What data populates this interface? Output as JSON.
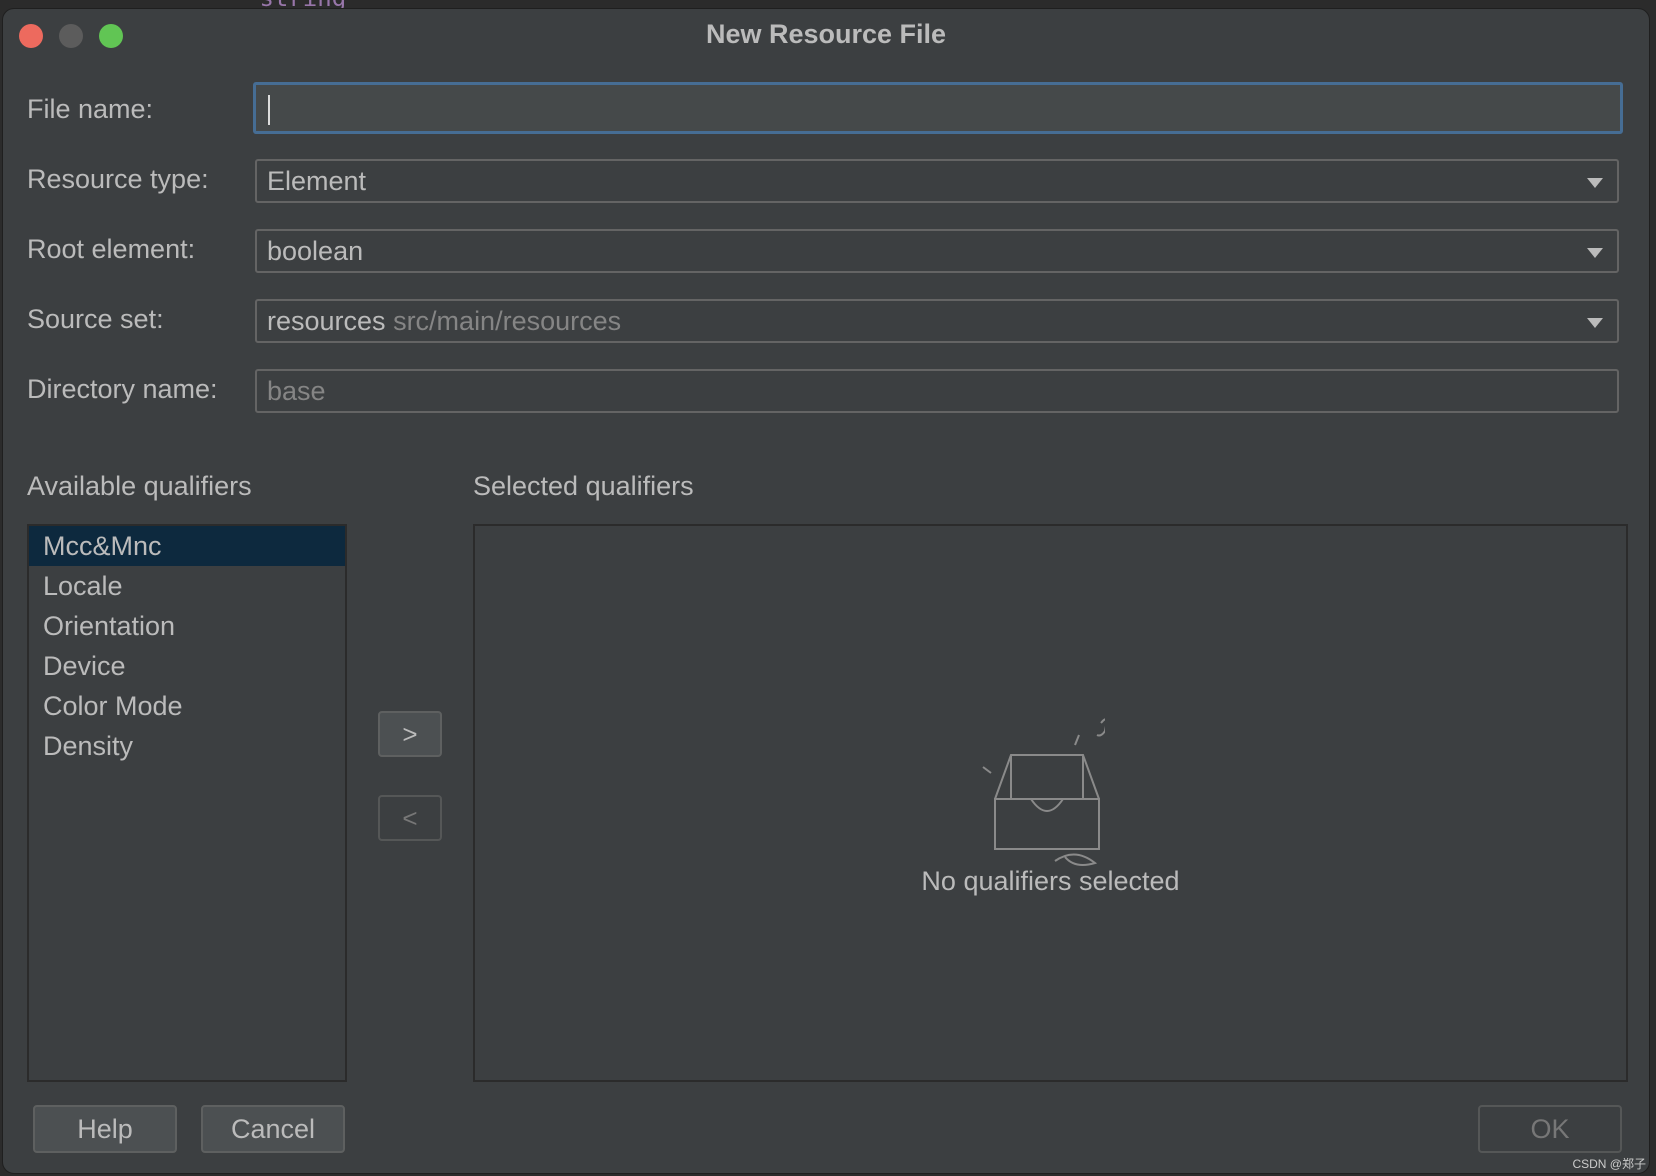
{
  "background_code_fragment": "\"string\"",
  "dialog": {
    "title": "New Resource File",
    "fields": {
      "file_name": {
        "label": "File name:",
        "value": ""
      },
      "resource_type": {
        "label": "Resource type:",
        "value": "Element"
      },
      "root_element": {
        "label": "Root element:",
        "value": "boolean"
      },
      "source_set": {
        "label": "Source set:",
        "value": "resources",
        "hint": "src/main/resources"
      },
      "directory_name": {
        "label": "Directory name:",
        "value": "base"
      }
    },
    "available_qualifiers": {
      "title": "Available qualifiers",
      "items": [
        "Mcc&Mnc",
        "Locale",
        "Orientation",
        "Device",
        "Color Mode",
        "Density"
      ],
      "selected_index": 0
    },
    "move_buttons": {
      "add": ">",
      "remove": "<"
    },
    "selected_qualifiers": {
      "title": "Selected qualifiers",
      "empty_text": "No qualifiers selected"
    },
    "buttons": {
      "help": "Help",
      "cancel": "Cancel",
      "ok": "OK"
    }
  },
  "watermark": "CSDN @郑子",
  "colors": {
    "dialog_bg": "#3c3f41",
    "text": "#bbbbbb",
    "focus_border": "#466d94",
    "selection_bg": "#0d293e",
    "traffic_close": "#ed6a5e",
    "traffic_max": "#61c554"
  }
}
